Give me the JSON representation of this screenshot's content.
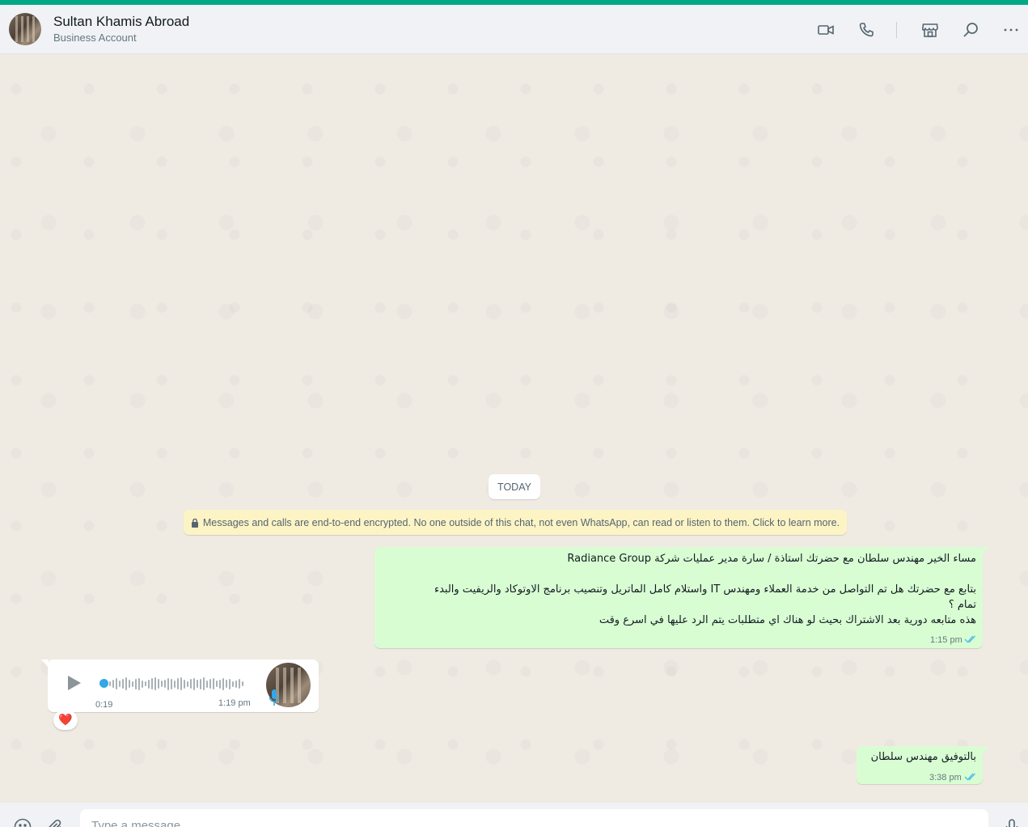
{
  "header": {
    "contact_name": "Sultan Khamis Abroad",
    "contact_subtitle": "Business Account",
    "icons": [
      "video-call-icon",
      "voice-call-icon",
      "catalog-icon",
      "search-icon",
      "menu-icon"
    ]
  },
  "chat": {
    "date_chip": "TODAY",
    "encryption_notice": "Messages and calls are end-to-end encrypted. No one outside of this chat, not even WhatsApp, can read or listen to them. Click to learn more.",
    "messages": [
      {
        "direction": "outgoing",
        "lines": [
          "مساء الخير مهندس سلطان مع حضرتك استاذة / سارة مدير عمليات شركة Radiance Group",
          "",
          "بتابع مع حضرتك هل تم التواصل من خدمة العملاء ومهندس IT واستلام كامل الماتريل وتنصيب برنامج الاوتوكاد والريفيت والبدء",
          "تمام ؟",
          "هذه متابعه دورية بعد الاشتراك بحيث لو هناك اي متطلبات يتم الرد عليها في اسرع وقت"
        ],
        "time": "1:15 pm",
        "status": "read"
      },
      {
        "direction": "incoming",
        "type": "voice",
        "duration": "0:19",
        "time": "1:19 pm",
        "reaction": "❤️"
      },
      {
        "direction": "outgoing",
        "lines": [
          "بالتوفيق مهندس سلطان"
        ],
        "time": "3:38 pm",
        "status": "read"
      }
    ]
  },
  "composer": {
    "placeholder": "Type a message",
    "icons": [
      "emoji-icon",
      "attach-icon",
      "mic-icon"
    ]
  },
  "colors": {
    "accent": "#00a884",
    "outgoing_bubble": "#d9fdd3",
    "incoming_bubble": "#ffffff",
    "read_ticks": "#53bdeb",
    "encryption_bg": "#fdf4c5",
    "chat_bg": "#efeae2"
  }
}
